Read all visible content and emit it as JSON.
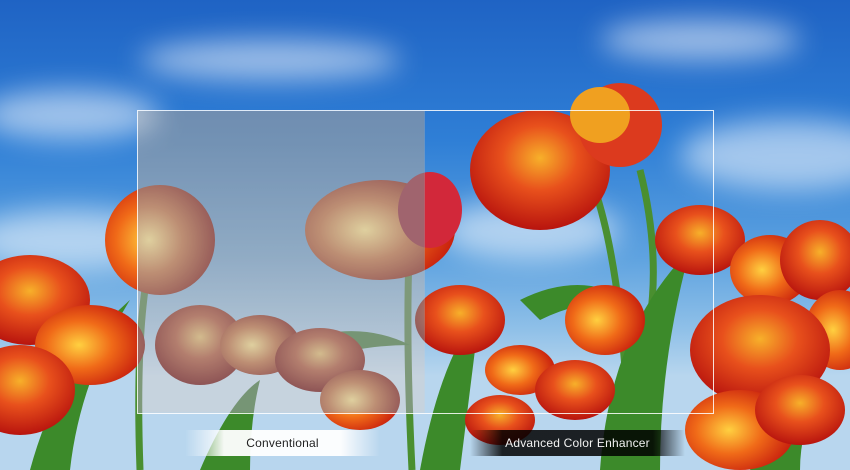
{
  "comparison": {
    "left_label": "Conventional",
    "right_label": "Advanced Color Enhancer"
  },
  "colors": {
    "sky_top": "#1f63c4",
    "sky_bottom": "#b8d6ee",
    "tulip_red": "#e0301c",
    "tulip_orange": "#f07a1a",
    "stem_green": "#3f8a2e"
  }
}
